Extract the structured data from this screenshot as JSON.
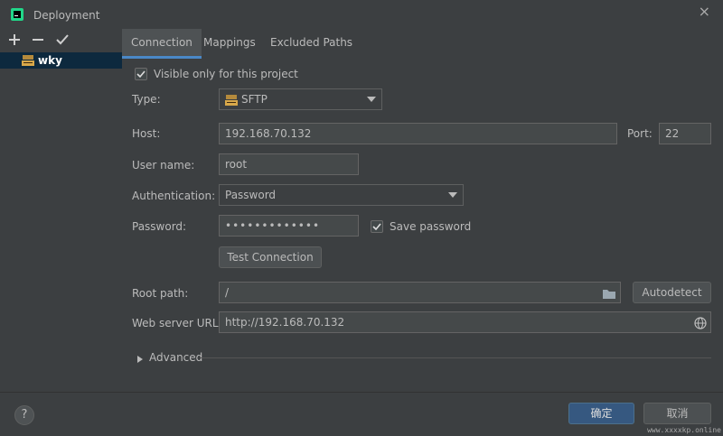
{
  "window": {
    "title": "Deployment",
    "close_glyph": "×"
  },
  "toolbar": {
    "add_glyph": "+",
    "remove_glyph": "−",
    "apply_glyph": "✓"
  },
  "server_list": [
    {
      "name": "wky",
      "icon": "sftp-server-icon"
    }
  ],
  "tabs": [
    {
      "label": "Connection",
      "active": true
    },
    {
      "label": "Mappings",
      "active": false
    },
    {
      "label": "Excluded Paths",
      "active": false
    }
  ],
  "form": {
    "visible_only_label": "Visible only for this project",
    "visible_only_checked": true,
    "type_label": "Type:",
    "type_value": "SFTP",
    "host_label": "Host:",
    "host_value": "192.168.70.132",
    "port_label": "Port:",
    "port_value": "22",
    "username_label": "User name:",
    "username_value": "root",
    "auth_label": "Authentication:",
    "auth_value": "Password",
    "password_label": "Password:",
    "password_value": "•••••••••••••",
    "save_password_label": "Save password",
    "save_password_checked": true,
    "test_connection_label": "Test Connection",
    "root_path_label": "Root path:",
    "root_path_value": "/",
    "autodetect_label": "Autodetect",
    "web_url_label": "Web server URL:",
    "web_url_value": "http://192.168.70.132",
    "advanced_label": "Advanced"
  },
  "footer": {
    "help_glyph": "?",
    "ok_label": "确定",
    "cancel_label": "取消"
  },
  "watermark": "www.xxxxkp.online",
  "colors": {
    "accent": "#4a88c7",
    "selection": "#0d293e",
    "primary_button": "#365880",
    "background": "#3c3f41"
  }
}
